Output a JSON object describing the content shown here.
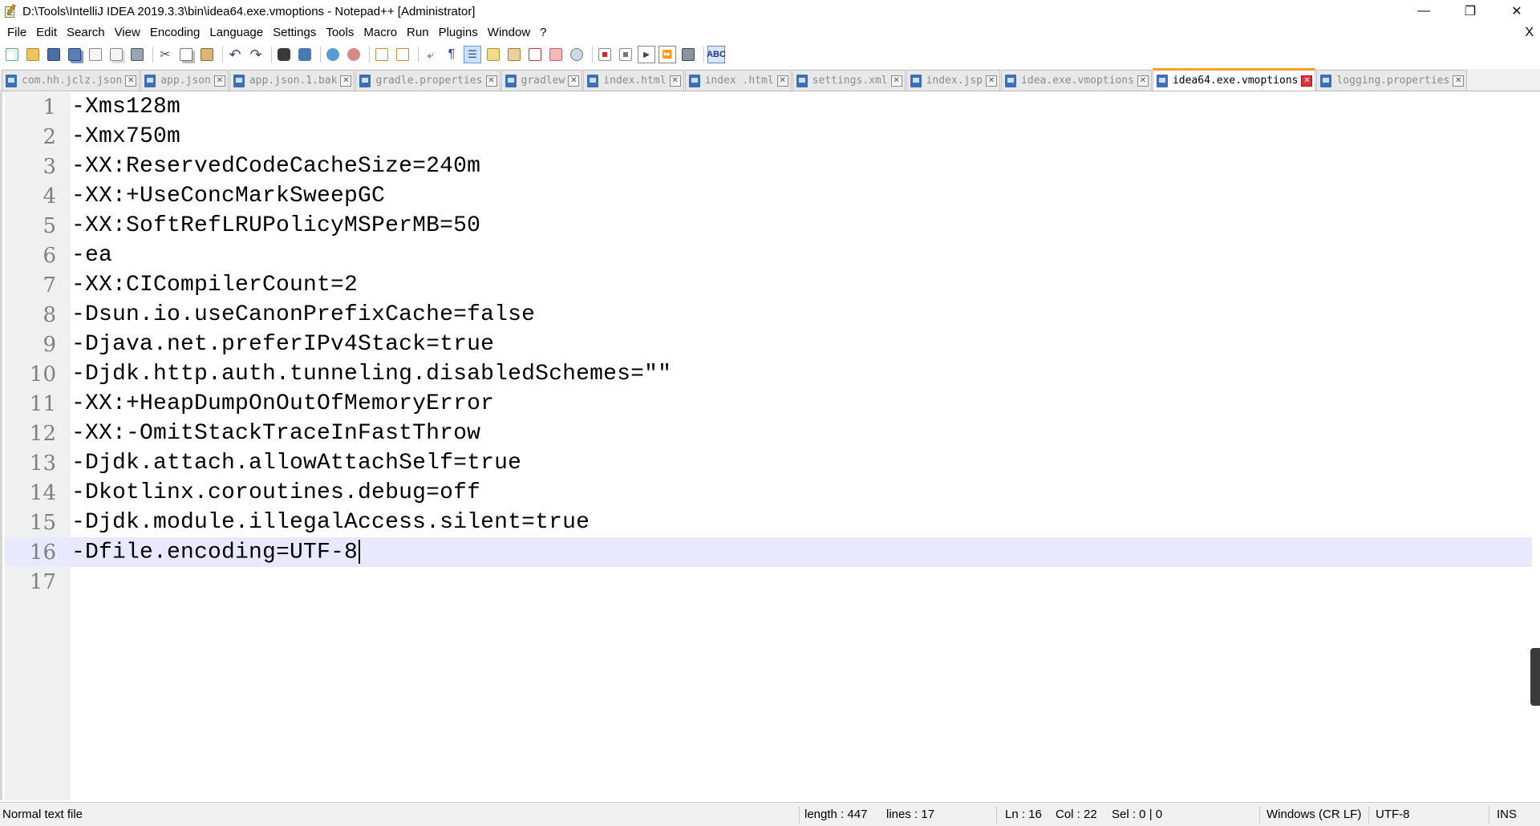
{
  "window": {
    "title": "D:\\Tools\\IntelliJ IDEA 2019.3.3\\bin\\idea64.exe.vmoptions - Notepad++ [Administrator]",
    "minimize": "—",
    "restore": "❐",
    "close": "✕"
  },
  "menu": {
    "items": [
      "File",
      "Edit",
      "Search",
      "View",
      "Encoding",
      "Language",
      "Settings",
      "Tools",
      "Macro",
      "Run",
      "Plugins",
      "Window",
      "?"
    ],
    "close_doc": "X"
  },
  "toolbar": {
    "icons": [
      "new-file-icon",
      "open-file-icon",
      "save-icon",
      "save-all-icon",
      "close-icon",
      "close-all-icon",
      "print-icon",
      "cut-icon",
      "copy-icon",
      "paste-icon",
      "undo-icon",
      "redo-icon",
      "find-icon",
      "replace-icon",
      "zoom-in-icon",
      "zoom-out-icon",
      "sync-vertical-icon",
      "sync-horizontal-icon",
      "word-wrap-icon",
      "show-all-chars-icon",
      "indent-guide-icon",
      "doc-map-icon",
      "function-list-icon",
      "folder-workspace-icon",
      "monitoring-icon",
      "record-macro-icon",
      "stop-macro-icon",
      "play-macro-icon",
      "run-macro-multiple-icon",
      "save-macro-icon",
      "spell-check-icon"
    ]
  },
  "tabs": [
    {
      "label": "com.hh.jclz.json",
      "active": false
    },
    {
      "label": "app.json",
      "active": false
    },
    {
      "label": "app.json.1.bak",
      "active": false
    },
    {
      "label": "gradle.properties",
      "active": false
    },
    {
      "label": "gradlew",
      "active": false
    },
    {
      "label": "index.html",
      "active": false
    },
    {
      "label": "index .html",
      "active": false
    },
    {
      "label": "settings.xml",
      "active": false
    },
    {
      "label": "index.jsp",
      "active": false
    },
    {
      "label": "idea.exe.vmoptions",
      "active": false
    },
    {
      "label": "idea64.exe.vmoptions",
      "active": true
    },
    {
      "label": "logging.properties",
      "active": false
    }
  ],
  "editor": {
    "lines": [
      "-Xms128m",
      "-Xmx750m",
      "-XX:ReservedCodeCacheSize=240m",
      "-XX:+UseConcMarkSweepGC",
      "-XX:SoftRefLRUPolicyMSPerMB=50",
      "-ea",
      "-XX:CICompilerCount=2",
      "-Dsun.io.useCanonPrefixCache=false",
      "-Djava.net.preferIPv4Stack=true",
      "-Djdk.http.auth.tunneling.disabledSchemes=\"\"",
      "-XX:+HeapDumpOnOutOfMemoryError",
      "-XX:-OmitStackTraceInFastThrow",
      "-Djdk.attach.allowAttachSelf=true",
      "-Dkotlinx.coroutines.debug=off",
      "-Djdk.module.illegalAccess.silent=true",
      "-Dfile.encoding=UTF-8",
      ""
    ],
    "line_numbers": [
      "1",
      "2",
      "3",
      "4",
      "5",
      "6",
      "7",
      "8",
      "9",
      "10",
      "11",
      "12",
      "13",
      "14",
      "15",
      "16",
      "17"
    ],
    "current_line": 16
  },
  "status": {
    "file_type": "Normal text file",
    "length": "length : 447",
    "lines": "lines : 17",
    "ln": "Ln : 16",
    "col": "Col : 22",
    "sel": "Sel : 0 | 0",
    "eol": "Windows (CR LF)",
    "encoding": "UTF-8",
    "mode": "INS"
  },
  "colors": {
    "current_line_bg": "#e8e8ff",
    "active_tab_accent": "#fa9d2e",
    "gutter_bg": "#f0f0f0"
  }
}
